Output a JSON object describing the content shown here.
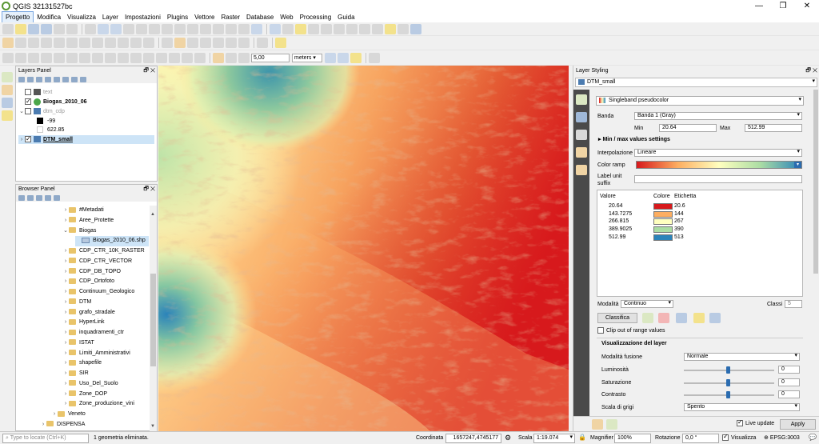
{
  "window": {
    "title": "QGIS 32131527bc",
    "controls": [
      "—",
      "❐",
      "✕"
    ]
  },
  "menu": [
    "Progetto",
    "Modifica",
    "Visualizza",
    "Layer",
    "Impostazioni",
    "Plugins",
    "Vettore",
    "Raster",
    "Database",
    "Web",
    "Processing",
    "Guida"
  ],
  "toolbar3": {
    "snap_value": "5,00",
    "units": "meters"
  },
  "layers_panel": {
    "title": "Layers Panel",
    "items": [
      {
        "name": "text",
        "checked": false,
        "dim": true
      },
      {
        "name": "Biogas_2010_06",
        "checked": true,
        "bold": true
      },
      {
        "name": "dtm_cdp",
        "checked": false,
        "dim": true,
        "expanded": true
      },
      {
        "name": "-99",
        "swatch": "#000000"
      },
      {
        "name": "622.85",
        "swatch": "#ffffff"
      },
      {
        "name": "DTM_small",
        "checked": true,
        "bold": true,
        "selected": true
      }
    ]
  },
  "browser_panel": {
    "title": "Browser Panel",
    "items": [
      "#Metadati",
      "Aree_Protette",
      "Biogas",
      "Biogas_2010_06.shp",
      "CDP_CTR_10K_RASTER",
      "CDP_CTR_VECTOR",
      "CDP_DB_TOPO",
      "CDP_Ortofoto",
      "Continuum_Geologico",
      "DTM",
      "grafo_stradale",
      "HyperLink",
      "inquadramenti_ctr",
      "ISTAT",
      "Limiti_Amministrativi",
      "shapefile",
      "SIR",
      "Uso_Del_Suolo",
      "Zone_DOP",
      "Zone_produzione_vini",
      "Veneto",
      "DISPENSA"
    ]
  },
  "styling": {
    "title": "Layer Styling",
    "layer": "DTM_small",
    "renderer": "Singleband pseudocolor",
    "banda_label": "Banda",
    "banda_value": "Banda 1 (Gray)",
    "min_label": "Min",
    "min_value": "20.64",
    "max_label": "Max",
    "max_value": "512.99",
    "minmax_section": "Min / max values settings",
    "interp_label": "Interpolazione",
    "interp_value": "Lineare",
    "ramp_label": "Color ramp",
    "unit_label": "Label unit suffix",
    "table_headers": {
      "value": "Valore",
      "color": "Colore",
      "label": "Etichetta"
    },
    "classes": [
      {
        "value": "20.64",
        "color": "#d7191c",
        "label": "20.6"
      },
      {
        "value": "143.7275",
        "color": "#fdae61",
        "label": "144"
      },
      {
        "value": "266.815",
        "color": "#ffffbf",
        "label": "267"
      },
      {
        "value": "389.9025",
        "color": "#abdda4",
        "label": "390"
      },
      {
        "value": "512.99",
        "color": "#2b83ba",
        "label": "513"
      }
    ],
    "mode_label": "Modalità",
    "mode_value": "Continuo",
    "classes_label": "Classi",
    "classes_value": "5",
    "classify_btn": "Classifica",
    "clip_label": "Clip out of range values",
    "render_section": "Visualizzazione del layer",
    "blend_label": "Modalità fusione",
    "blend_value": "Normale",
    "brightness_label": "Luminosità",
    "brightness_value": "0",
    "saturation_label": "Saturazione",
    "saturation_value": "0",
    "contrast_label": "Contrasto",
    "contrast_value": "0",
    "gray_label": "Scala di grigi",
    "gray_value": "Spento",
    "live_update": "Live update",
    "apply": "Apply"
  },
  "status": {
    "locate_placeholder": "Type to locate (Ctrl+K)",
    "message": "1 geometria eliminata.",
    "coord_label": "Coordinata",
    "coord_value": "1657247,4745177",
    "scale_label": "Scala",
    "scale_value": "1:19.074",
    "magnifier_label": "Magnifier",
    "magnifier_value": "100%",
    "rotation_label": "Rotazione",
    "rotation_value": "0,0 °",
    "render_label": "Visualizza",
    "crs": "EPSG:3003"
  },
  "colors": {
    "accent": "#2b6cb0",
    "selection": "#cde4f7"
  }
}
